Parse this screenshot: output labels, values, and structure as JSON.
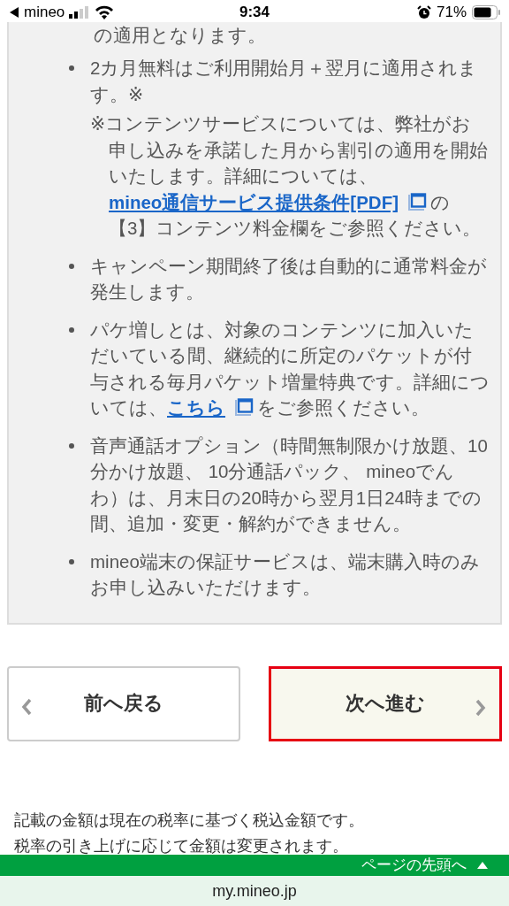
{
  "status_bar": {
    "back_label": "mineo",
    "time": "9:34",
    "battery": "71%"
  },
  "notes_box": {
    "continuation": "の適用となります。",
    "items": [
      {
        "parts": [
          {
            "kind": "text",
            "text": "2カ月無料はご利用開始月＋翌月に適用されます。※"
          }
        ],
        "subnote": {
          "parts": [
            {
              "kind": "text",
              "text": "※コンテンツサービスについては、弊社がお申し込みを承諾した月から割引の適用を開始いたします。詳細については、"
            },
            {
              "kind": "link",
              "text": "mineo通信サービス提供条件[PDF]"
            },
            {
              "kind": "window-icon"
            },
            {
              "kind": "text",
              "text": "の【3】コンテンツ料金欄をご参照ください。"
            }
          ]
        }
      },
      {
        "parts": [
          {
            "kind": "text",
            "text": "キャンペーン期間終了後は自動的に通常料金が発生します。"
          }
        ]
      },
      {
        "parts": [
          {
            "kind": "text",
            "text": "パケ増しとは、対象のコンテンツに加入いただいている間、継続的に所定のパケットが付与される毎月パケット増量特典です。詳細については、"
          },
          {
            "kind": "link",
            "text": "こちら"
          },
          {
            "kind": "window-icon"
          },
          {
            "kind": "text",
            "text": "をご参照ください。"
          }
        ]
      },
      {
        "parts": [
          {
            "kind": "text",
            "text": "音声通話オプション（時間無制限かけ放題、10分かけ放題、 10分通話パック、 mineoでんわ）は、月末日の20時から翌月1日24時までの間、追加・変更・解約ができません。"
          }
        ]
      },
      {
        "parts": [
          {
            "kind": "text",
            "text": "mineo端末の保証サービスは、端末購入時のみお申し込みいただけます。"
          }
        ]
      }
    ]
  },
  "nav_buttons": [
    {
      "kind": "prev",
      "label": "前へ戻る",
      "highlighted": false
    },
    {
      "kind": "next",
      "label": "次へ進む",
      "highlighted": true
    }
  ],
  "tax_note": [
    "記載の金額は現在の税率に基づく税込金額です。",
    "税率の引き上げに応じて金額は変更されます。"
  ],
  "page_top_bar": {
    "label": "ページの先頭へ"
  },
  "url_bar": {
    "url": "my.mineo.jp"
  }
}
